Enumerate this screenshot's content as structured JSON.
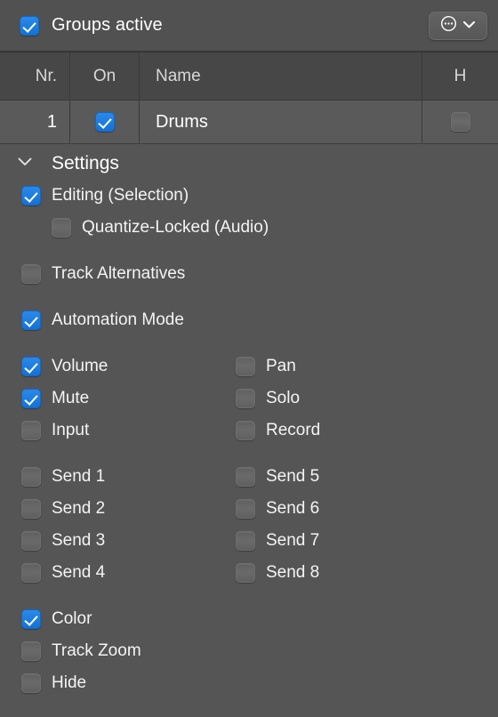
{
  "topbar": {
    "groups_active_label": "Groups active",
    "groups_active_checked": true,
    "menu_icon": "ellipsis-circle-icon",
    "chevron_icon": "chevron-down-icon"
  },
  "table": {
    "columns": [
      "Nr.",
      "On",
      "Name",
      "H"
    ],
    "rows": [
      {
        "nr": "1",
        "on": true,
        "name": "Drums",
        "h": false
      }
    ]
  },
  "settings": {
    "title": "Settings",
    "expanded": true,
    "disclosure_icon": "chevron-down-icon",
    "groups": [
      {
        "name": "editing-group",
        "layout": "single",
        "items": [
          {
            "label": "Editing (Selection)",
            "checked": true,
            "indent": false
          },
          {
            "label": "Quantize-Locked (Audio)",
            "checked": false,
            "indent": true
          }
        ]
      },
      {
        "name": "track-alternatives-group",
        "layout": "single",
        "items": [
          {
            "label": "Track Alternatives",
            "checked": false,
            "indent": false
          }
        ]
      },
      {
        "name": "automation-group",
        "layout": "single",
        "items": [
          {
            "label": "Automation Mode",
            "checked": false,
            "indent": false
          }
        ]
      },
      {
        "name": "mixer-controls-group",
        "layout": "double",
        "pairs": [
          {
            "left": {
              "label": "Volume",
              "checked": true
            },
            "right": {
              "label": "Pan",
              "checked": false
            }
          },
          {
            "left": {
              "label": "Mute",
              "checked": true
            },
            "right": {
              "label": "Solo",
              "checked": false
            }
          },
          {
            "left": {
              "label": "Input",
              "checked": false
            },
            "right": {
              "label": "Record",
              "checked": false
            }
          }
        ]
      },
      {
        "name": "sends-group",
        "layout": "double",
        "pairs": [
          {
            "left": {
              "label": "Send 1",
              "checked": false
            },
            "right": {
              "label": "Send 5",
              "checked": false
            }
          },
          {
            "left": {
              "label": "Send 2",
              "checked": false
            },
            "right": {
              "label": "Send 6",
              "checked": false
            }
          },
          {
            "left": {
              "label": "Send 3",
              "checked": false
            },
            "right": {
              "label": "Send 7",
              "checked": false
            }
          },
          {
            "left": {
              "label": "Send 4",
              "checked": false
            },
            "right": {
              "label": "Send 8",
              "checked": false
            }
          }
        ]
      },
      {
        "name": "appearance-group",
        "layout": "single",
        "items": [
          {
            "label": "Color",
            "checked": true,
            "indent": false
          },
          {
            "label": "Track Zoom",
            "checked": false,
            "indent": false
          },
          {
            "label": "Hide",
            "checked": false,
            "indent": false
          }
        ]
      }
    ]
  },
  "colors": {
    "accent": "#1272d8",
    "panel_bg": "#555555",
    "topbar_bg": "#515151",
    "header_bg": "#474747",
    "row_bg": "#5a5a5a",
    "text": "#ffffff"
  }
}
